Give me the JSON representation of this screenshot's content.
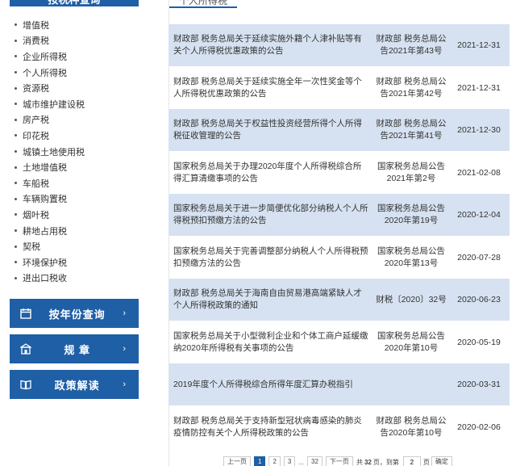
{
  "sidebar": {
    "header": "按税种查询",
    "taxes": [
      "增值税",
      "消费税",
      "企业所得税",
      "个人所得税",
      "资源税",
      "城市维护建设税",
      "房产税",
      "印花税",
      "城镇土地使用税",
      "土地增值税",
      "车船税",
      "车辆购置税",
      "烟叶税",
      "耕地占用税",
      "契税",
      "环境保护税",
      "进出口税收"
    ],
    "buttons": [
      {
        "label": "按年份查询",
        "arrow": "›"
      },
      {
        "label": "规  章",
        "arrow": "›"
      },
      {
        "label": "政策解读",
        "arrow": "›"
      }
    ]
  },
  "main": {
    "tab": "个人所得税",
    "rows": [
      {
        "title": "财政部 税务总局关于延续实施外籍个人津补贴等有关个人所得税优惠政策的公告",
        "doc": "财政部 税务总局公告2021年第43号",
        "date": "2021-12-31"
      },
      {
        "title": "财政部 税务总局关于延续实施全年一次性奖金等个人所得税优惠政策的公告",
        "doc": "财政部 税务总局公告2021年第42号",
        "date": "2021-12-31"
      },
      {
        "title": "财政部 税务总局关于权益性投资经营所得个人所得税征收管理的公告",
        "doc": "财政部 税务总局公告2021年第41号",
        "date": "2021-12-30"
      },
      {
        "title": "国家税务总局关于办理2020年度个人所得税综合所得汇算清缴事项的公告",
        "doc": "国家税务总局公告2021年第2号",
        "date": "2021-02-08"
      },
      {
        "title": "国家税务总局关于进一步简便优化部分纳税人个人所得税预扣预缴方法的公告",
        "doc": "国家税务总局公告2020年第19号",
        "date": "2020-12-04"
      },
      {
        "title": "国家税务总局关于完善调整部分纳税人个人所得税预扣预缴方法的公告",
        "doc": "国家税务总局公告2020年第13号",
        "date": "2020-07-28"
      },
      {
        "title": "财政部 税务总局关于海南自由贸易港高端紧缺人才个人所得税政策的通知",
        "doc": "财税〔2020〕32号",
        "date": "2020-06-23"
      },
      {
        "title": "国家税务总局关于小型微利企业和个体工商户延缓缴纳2020年所得税有关事项的公告",
        "doc": "国家税务总局公告2020年第10号",
        "date": "2020-05-19"
      },
      {
        "title": "2019年度个人所得税综合所得年度汇算办税指引",
        "doc": "",
        "date": "2020-03-31"
      },
      {
        "title": "财政部 税务总局关于支持新型冠状病毒感染的肺炎疫情防控有关个人所得税政策的公告",
        "doc": "财政部 税务总局公告2020年第10号",
        "date": "2020-02-06"
      }
    ]
  },
  "pager": {
    "prev": "上一页",
    "pages": [
      "1",
      "2",
      "3",
      "...",
      "32"
    ],
    "next": "下一页",
    "total_prefix": "共",
    "total": "32",
    "total_suffix": "页，到第",
    "goto_value": "2",
    "page_unit": "页",
    "confirm": "确定"
  },
  "colors": {
    "accent": "#1f5fa6",
    "row_shade": "#d6e2f1"
  }
}
